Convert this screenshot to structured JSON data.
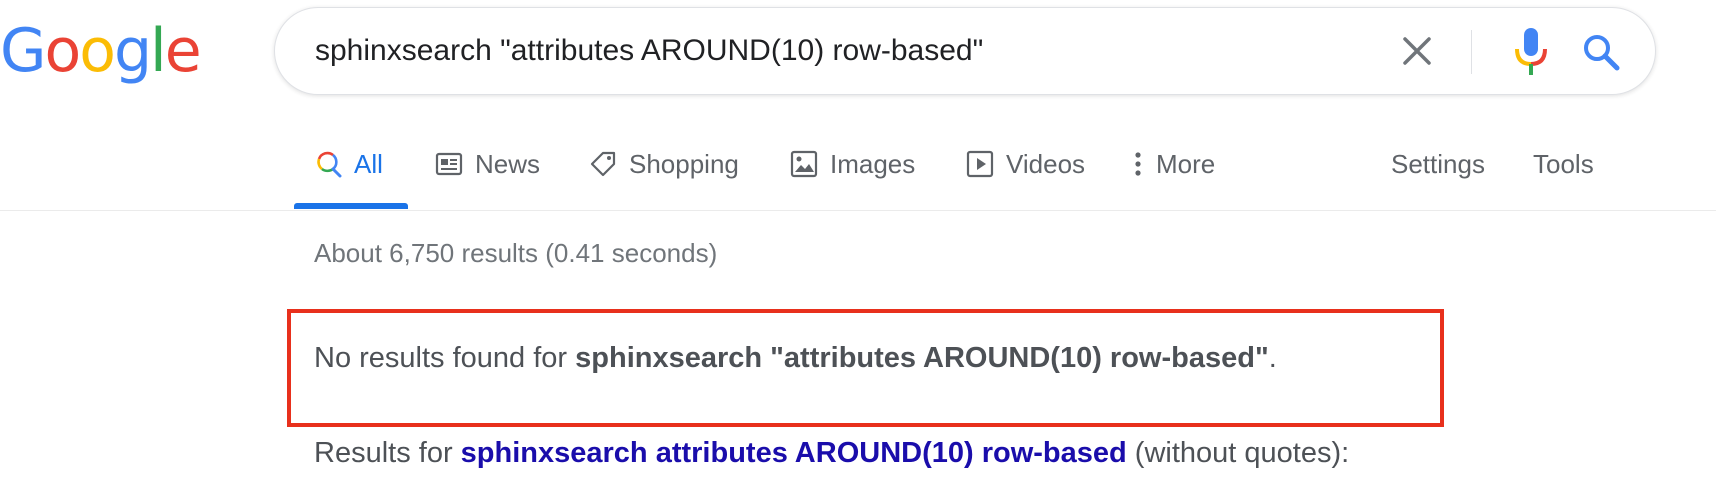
{
  "logo": {
    "letters": [
      "G",
      "o",
      "o",
      "g",
      "l",
      "e"
    ],
    "colors": [
      "#4285F4",
      "#EA4335",
      "#FBBC05",
      "#4285F4",
      "#34A853",
      "#EA4335"
    ]
  },
  "search": {
    "query": "sphinxsearch \"attributes AROUND(10) row-based\"",
    "clear_icon": "close-icon",
    "mic_icon": "microphone-icon",
    "search_icon": "search-icon"
  },
  "tabs": {
    "items": [
      {
        "label": "All",
        "icon": "search-icon",
        "active": true
      },
      {
        "label": "News",
        "icon": "newspaper-icon",
        "active": false
      },
      {
        "label": "Shopping",
        "icon": "tag-icon",
        "active": false
      },
      {
        "label": "Images",
        "icon": "image-icon",
        "active": false
      },
      {
        "label": "Videos",
        "icon": "play-icon",
        "active": false
      },
      {
        "label": "More",
        "icon": "vertical-dots-icon",
        "active": false
      }
    ],
    "settings": "Settings",
    "tools": "Tools",
    "accent": "#1a73e8"
  },
  "results": {
    "stats": "About 6,750 results (0.41 seconds)",
    "no_results_prefix": "No results found for ",
    "no_results_query": "sphinxsearch \"attributes AROUND(10) row-based\"",
    "no_results_suffix": ".",
    "results_for_prefix": "Results for ",
    "results_for_link": "sphinxsearch attributes AROUND(10) row-based",
    "results_for_suffix": " (without quotes):",
    "highlight_color": "#e8301c",
    "link_color": "#1a0dab"
  }
}
